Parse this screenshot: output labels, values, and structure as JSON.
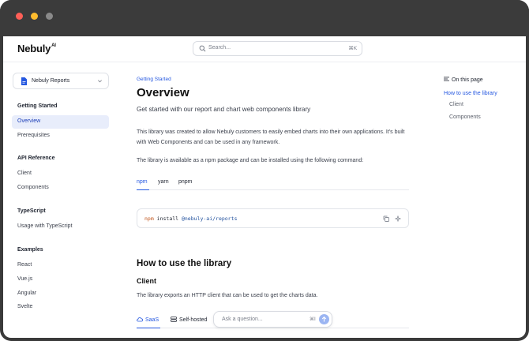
{
  "window": {
    "controls": [
      "close",
      "minimize",
      "zoom"
    ]
  },
  "header": {
    "logo_text": "Nebuly",
    "logo_sup": "AI",
    "search": {
      "placeholder": "Search...",
      "shortcut": "⌘K",
      "icon": "search-icon"
    }
  },
  "sidebar": {
    "product": {
      "name": "Nebuly Reports",
      "icon": "document-icon"
    },
    "sections": [
      {
        "heading": "Getting Started",
        "items": [
          "Overview",
          "Prerequisites"
        ]
      },
      {
        "heading": "API Reference",
        "items": [
          "Client",
          "Components"
        ]
      },
      {
        "heading": "TypeScript",
        "items": [
          "Usage with TypeScript"
        ]
      },
      {
        "heading": "Examples",
        "items": [
          "React",
          "Vue.js",
          "Angular",
          "Svelte"
        ]
      }
    ],
    "active_item": "Overview"
  },
  "main": {
    "breadcrumb": "Getting Started",
    "title": "Overview",
    "subtitle": "Get started with our report and chart web components library",
    "intro": "This library was created to allow Nebuly customers to easily embed charts into their own applications. It's built with Web Components and can be used in any framework.",
    "install_text": "The library is available as a npm package and can be installed using the following command:",
    "tabs": [
      "npm",
      "yarn",
      "pnpm"
    ],
    "active_tab": "npm",
    "code": {
      "command": "npm",
      "rest": " install ",
      "package": "@nebuly-ai/reports"
    },
    "section_title": "How to use the library",
    "subsection_title": "Client",
    "client_text": "The library exports an HTTP client that can be used to get the charts data.",
    "env_tabs": [
      {
        "label": "SaaS",
        "icon": "cloud-icon"
      },
      {
        "label": "Self-hosted",
        "icon": "server-icon"
      }
    ],
    "active_env_tab": "SaaS",
    "ask": {
      "placeholder": "Ask a question...",
      "shortcut": "⌘I"
    }
  },
  "toc": {
    "title": "On this page",
    "items": [
      {
        "label": "How to use the library",
        "active": true
      },
      {
        "label": "Client",
        "active": false
      },
      {
        "label": "Components",
        "active": false
      }
    ]
  },
  "colors": {
    "accent": "#2457e0",
    "active_bg": "#e8edfb",
    "titlebar": "#3b3b3b"
  }
}
